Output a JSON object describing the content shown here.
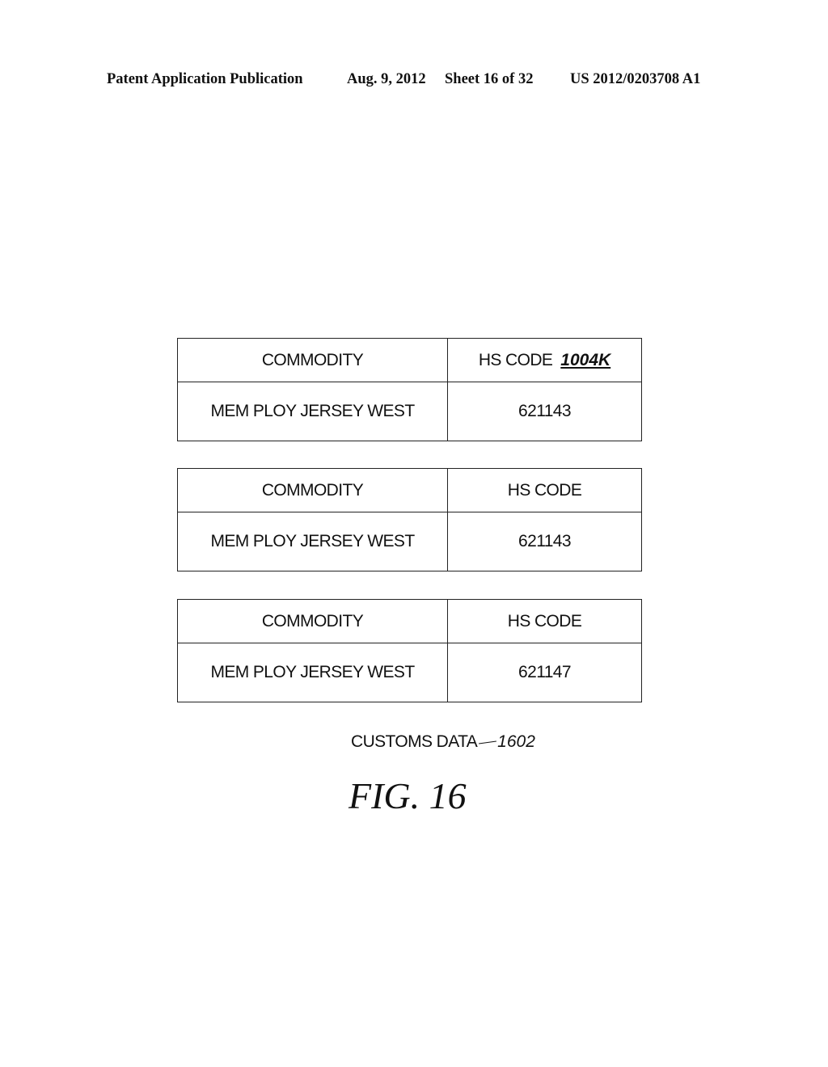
{
  "header": {
    "publication": "Patent Application Publication",
    "date": "Aug. 9, 2012",
    "sheet": "Sheet 16 of 32",
    "number": "US 2012/0203708 A1"
  },
  "tables": [
    {
      "header": {
        "commodity": "COMMODITY",
        "hs_code": "HS CODE",
        "ref": "1004K"
      },
      "row": {
        "commodity": "MEM PLOY JERSEY WEST",
        "hs_code": "621143"
      }
    },
    {
      "header": {
        "commodity": "COMMODITY",
        "hs_code": "HS CODE"
      },
      "row": {
        "commodity": "MEM PLOY JERSEY WEST",
        "hs_code": "621143"
      }
    },
    {
      "header": {
        "commodity": "COMMODITY",
        "hs_code": "HS CODE"
      },
      "row": {
        "commodity": "MEM PLOY JERSEY WEST",
        "hs_code": "621147"
      }
    }
  ],
  "caption": {
    "label": "CUSTOMS DATA",
    "ref": "1602"
  },
  "figure_label": "FIG. 16"
}
